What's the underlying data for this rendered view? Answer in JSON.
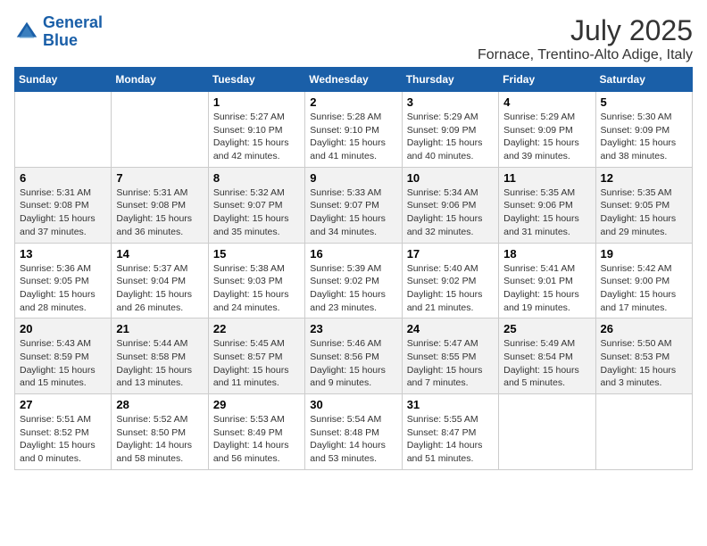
{
  "logo": {
    "line1": "General",
    "line2": "Blue"
  },
  "title": "July 2025",
  "subtitle": "Fornace, Trentino-Alto Adige, Italy",
  "days_header": [
    "Sunday",
    "Monday",
    "Tuesday",
    "Wednesday",
    "Thursday",
    "Friday",
    "Saturday"
  ],
  "weeks": [
    [
      {
        "day": "",
        "info": ""
      },
      {
        "day": "",
        "info": ""
      },
      {
        "day": "1",
        "info": "Sunrise: 5:27 AM\nSunset: 9:10 PM\nDaylight: 15 hours and 42 minutes."
      },
      {
        "day": "2",
        "info": "Sunrise: 5:28 AM\nSunset: 9:10 PM\nDaylight: 15 hours and 41 minutes."
      },
      {
        "day": "3",
        "info": "Sunrise: 5:29 AM\nSunset: 9:09 PM\nDaylight: 15 hours and 40 minutes."
      },
      {
        "day": "4",
        "info": "Sunrise: 5:29 AM\nSunset: 9:09 PM\nDaylight: 15 hours and 39 minutes."
      },
      {
        "day": "5",
        "info": "Sunrise: 5:30 AM\nSunset: 9:09 PM\nDaylight: 15 hours and 38 minutes."
      }
    ],
    [
      {
        "day": "6",
        "info": "Sunrise: 5:31 AM\nSunset: 9:08 PM\nDaylight: 15 hours and 37 minutes."
      },
      {
        "day": "7",
        "info": "Sunrise: 5:31 AM\nSunset: 9:08 PM\nDaylight: 15 hours and 36 minutes."
      },
      {
        "day": "8",
        "info": "Sunrise: 5:32 AM\nSunset: 9:07 PM\nDaylight: 15 hours and 35 minutes."
      },
      {
        "day": "9",
        "info": "Sunrise: 5:33 AM\nSunset: 9:07 PM\nDaylight: 15 hours and 34 minutes."
      },
      {
        "day": "10",
        "info": "Sunrise: 5:34 AM\nSunset: 9:06 PM\nDaylight: 15 hours and 32 minutes."
      },
      {
        "day": "11",
        "info": "Sunrise: 5:35 AM\nSunset: 9:06 PM\nDaylight: 15 hours and 31 minutes."
      },
      {
        "day": "12",
        "info": "Sunrise: 5:35 AM\nSunset: 9:05 PM\nDaylight: 15 hours and 29 minutes."
      }
    ],
    [
      {
        "day": "13",
        "info": "Sunrise: 5:36 AM\nSunset: 9:05 PM\nDaylight: 15 hours and 28 minutes."
      },
      {
        "day": "14",
        "info": "Sunrise: 5:37 AM\nSunset: 9:04 PM\nDaylight: 15 hours and 26 minutes."
      },
      {
        "day": "15",
        "info": "Sunrise: 5:38 AM\nSunset: 9:03 PM\nDaylight: 15 hours and 24 minutes."
      },
      {
        "day": "16",
        "info": "Sunrise: 5:39 AM\nSunset: 9:02 PM\nDaylight: 15 hours and 23 minutes."
      },
      {
        "day": "17",
        "info": "Sunrise: 5:40 AM\nSunset: 9:02 PM\nDaylight: 15 hours and 21 minutes."
      },
      {
        "day": "18",
        "info": "Sunrise: 5:41 AM\nSunset: 9:01 PM\nDaylight: 15 hours and 19 minutes."
      },
      {
        "day": "19",
        "info": "Sunrise: 5:42 AM\nSunset: 9:00 PM\nDaylight: 15 hours and 17 minutes."
      }
    ],
    [
      {
        "day": "20",
        "info": "Sunrise: 5:43 AM\nSunset: 8:59 PM\nDaylight: 15 hours and 15 minutes."
      },
      {
        "day": "21",
        "info": "Sunrise: 5:44 AM\nSunset: 8:58 PM\nDaylight: 15 hours and 13 minutes."
      },
      {
        "day": "22",
        "info": "Sunrise: 5:45 AM\nSunset: 8:57 PM\nDaylight: 15 hours and 11 minutes."
      },
      {
        "day": "23",
        "info": "Sunrise: 5:46 AM\nSunset: 8:56 PM\nDaylight: 15 hours and 9 minutes."
      },
      {
        "day": "24",
        "info": "Sunrise: 5:47 AM\nSunset: 8:55 PM\nDaylight: 15 hours and 7 minutes."
      },
      {
        "day": "25",
        "info": "Sunrise: 5:49 AM\nSunset: 8:54 PM\nDaylight: 15 hours and 5 minutes."
      },
      {
        "day": "26",
        "info": "Sunrise: 5:50 AM\nSunset: 8:53 PM\nDaylight: 15 hours and 3 minutes."
      }
    ],
    [
      {
        "day": "27",
        "info": "Sunrise: 5:51 AM\nSunset: 8:52 PM\nDaylight: 15 hours and 0 minutes."
      },
      {
        "day": "28",
        "info": "Sunrise: 5:52 AM\nSunset: 8:50 PM\nDaylight: 14 hours and 58 minutes."
      },
      {
        "day": "29",
        "info": "Sunrise: 5:53 AM\nSunset: 8:49 PM\nDaylight: 14 hours and 56 minutes."
      },
      {
        "day": "30",
        "info": "Sunrise: 5:54 AM\nSunset: 8:48 PM\nDaylight: 14 hours and 53 minutes."
      },
      {
        "day": "31",
        "info": "Sunrise: 5:55 AM\nSunset: 8:47 PM\nDaylight: 14 hours and 51 minutes."
      },
      {
        "day": "",
        "info": ""
      },
      {
        "day": "",
        "info": ""
      }
    ]
  ]
}
